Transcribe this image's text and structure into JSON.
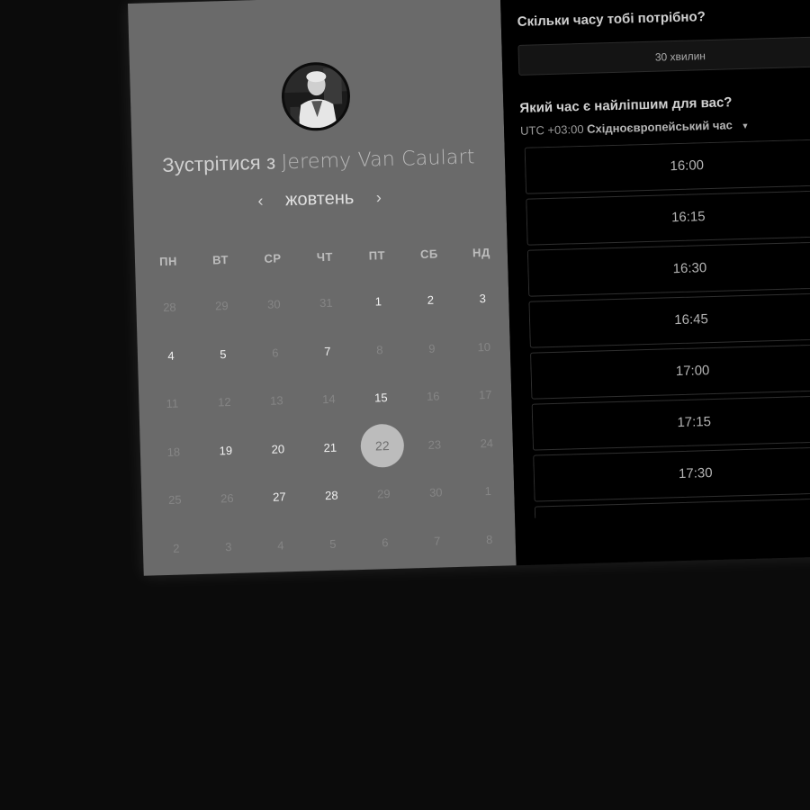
{
  "host": {
    "title_prefix": "Зустрітися з",
    "name": "Jeremy Van Caulart"
  },
  "calendar": {
    "month": "жовтень",
    "prev_label": "‹",
    "next_label": "›",
    "weekdays": [
      "ПН",
      "ВТ",
      "СР",
      "ЧТ",
      "ПТ",
      "СБ",
      "НД"
    ],
    "weeks": [
      [
        {
          "d": "28",
          "s": "off"
        },
        {
          "d": "29",
          "s": "off"
        },
        {
          "d": "30",
          "s": "off"
        },
        {
          "d": "31",
          "s": "off"
        },
        {
          "d": "1",
          "s": "avail"
        },
        {
          "d": "2",
          "s": "avail"
        },
        {
          "d": "3",
          "s": "avail"
        }
      ],
      [
        {
          "d": "4",
          "s": "avail"
        },
        {
          "d": "5",
          "s": "avail"
        },
        {
          "d": "6",
          "s": "off"
        },
        {
          "d": "7",
          "s": "avail"
        },
        {
          "d": "8",
          "s": "off"
        },
        {
          "d": "9",
          "s": "off"
        },
        {
          "d": "10",
          "s": "off"
        }
      ],
      [
        {
          "d": "11",
          "s": "off"
        },
        {
          "d": "12",
          "s": "off"
        },
        {
          "d": "13",
          "s": "off"
        },
        {
          "d": "14",
          "s": "off"
        },
        {
          "d": "15",
          "s": "avail"
        },
        {
          "d": "16",
          "s": "off"
        },
        {
          "d": "17",
          "s": "off"
        }
      ],
      [
        {
          "d": "18",
          "s": "off"
        },
        {
          "d": "19",
          "s": "avail"
        },
        {
          "d": "20",
          "s": "avail"
        },
        {
          "d": "21",
          "s": "avail"
        },
        {
          "d": "22",
          "s": "sel"
        },
        {
          "d": "23",
          "s": "off"
        },
        {
          "d": "24",
          "s": "off"
        }
      ],
      [
        {
          "d": "25",
          "s": "off"
        },
        {
          "d": "26",
          "s": "off"
        },
        {
          "d": "27",
          "s": "avail"
        },
        {
          "d": "28",
          "s": "avail"
        },
        {
          "d": "29",
          "s": "off"
        },
        {
          "d": "30",
          "s": "off"
        },
        {
          "d": "1",
          "s": "off"
        }
      ],
      [
        {
          "d": "2",
          "s": "off"
        },
        {
          "d": "3",
          "s": "off"
        },
        {
          "d": "4",
          "s": "off"
        },
        {
          "d": "5",
          "s": "off"
        },
        {
          "d": "6",
          "s": "off"
        },
        {
          "d": "7",
          "s": "off"
        },
        {
          "d": "8",
          "s": "off"
        }
      ]
    ]
  },
  "duration": {
    "question": "Скільки часу тобі потрібно?",
    "value": "30 хвилин"
  },
  "times": {
    "question": "Який час є найліпшим для вас?",
    "tz_offset": "UTC +03:00",
    "tz_name": "Східноєвропейський час",
    "slots": [
      "16:00",
      "16:15",
      "16:30",
      "16:45",
      "17:00",
      "17:15",
      "17:30",
      ""
    ]
  },
  "colors": {
    "left_panel": "#6a6a6a",
    "right_panel": "#000000",
    "selected_day": "#bcbcbc"
  },
  "icons": {
    "prev": "chevron-left-icon",
    "next": "chevron-right-icon",
    "timezone": "caret-down-icon"
  }
}
